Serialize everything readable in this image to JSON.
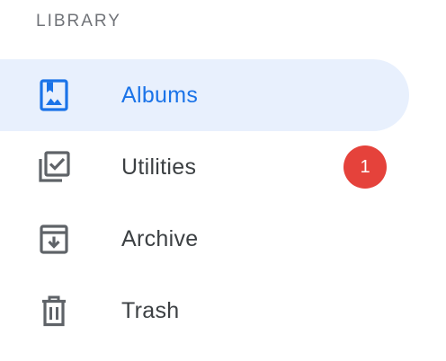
{
  "library": {
    "header": "LIBRARY",
    "items": [
      {
        "label": "Albums",
        "icon": "photo-album-icon",
        "active": true
      },
      {
        "label": "Utilities",
        "icon": "library-add-check-icon",
        "badge": "1"
      },
      {
        "label": "Archive",
        "icon": "archive-icon"
      },
      {
        "label": "Trash",
        "icon": "trash-icon"
      }
    ]
  },
  "colors": {
    "accent": "#1a73e8",
    "active_bg": "#e8f0fd",
    "badge": "#e5423b",
    "text": "#3c4043",
    "icon": "#5f6368",
    "header": "#707378"
  }
}
